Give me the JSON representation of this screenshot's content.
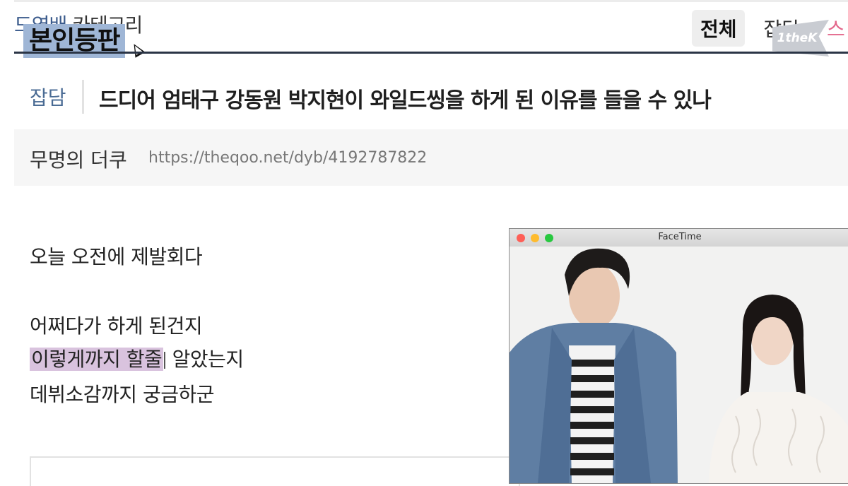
{
  "breadcrumb": {
    "board": "드영배",
    "label": "카테고리"
  },
  "caption_badge": "본인등판",
  "tabs": [
    {
      "label": "전체",
      "active": true
    },
    {
      "label": "잡담",
      "active": false
    },
    {
      "label": "스",
      "active": false
    }
  ],
  "logo": {
    "text": "1theK"
  },
  "post": {
    "category": "잡담",
    "title": "드디어 엄태구 강동원 박지현이 와일드씽을 하게 된 이유를 들을 수 있나",
    "author": "무명의 더쿠",
    "url": "https://theqoo.net/dyb/4192787822",
    "lines": [
      {
        "text": "오늘 오전에 제발회다"
      },
      {
        "text": "어쩌다가 하게 된건지"
      },
      {
        "highlight": "이렇게까지 할줄",
        "rest": " 알았는지"
      },
      {
        "text": "데뷔소감까지 궁금하군"
      }
    ]
  },
  "facetime": {
    "title": "FaceTime"
  },
  "colors": {
    "header_line": "#2b3546",
    "category": "#4a6b94",
    "highlight": "#d9c3de",
    "badge": "#9fb6d6"
  }
}
